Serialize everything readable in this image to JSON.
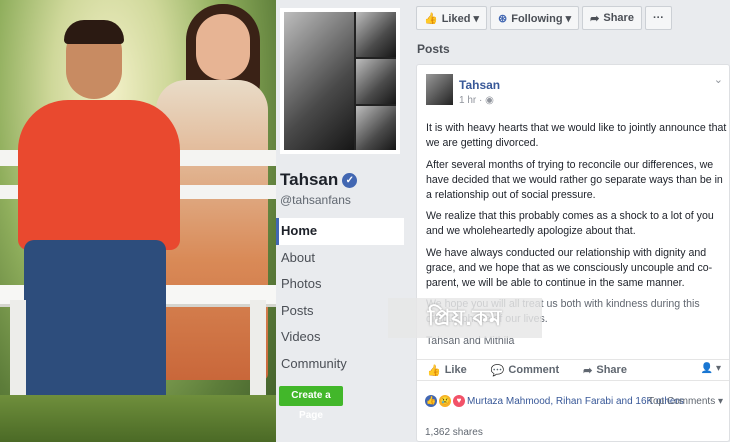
{
  "photo": {
    "alt": ""
  },
  "page": {
    "name": "Tahsan",
    "handle": "@tahsanfans",
    "verified_icon": "verified-check-icon"
  },
  "nav": [
    "Home",
    "About",
    "Photos",
    "Posts",
    "Videos",
    "Community"
  ],
  "create_page": "Create a Page",
  "topbar": {
    "liked": "Liked ▾",
    "following": "Following ▾",
    "share": "Share",
    "more": "···"
  },
  "posts_label": "Posts",
  "post": {
    "author": "Tahsan",
    "time": "1 hr · ◉",
    "paragraphs": [
      "It is with heavy hearts that we would like to jointly announce that we are getting divorced.",
      "After several months of trying to reconcile our differences, we have decided that we would rather go separate ways than be in a relationship out of social pressure.",
      "We realize that this probably comes as a shock to a lot of you and we wholeheartedly apologize about that.",
      "We have always conducted our relationship with dignity and grace, and we hope that as we consciously uncouple and co-parent, we will be able to continue in the same manner.",
      "We hope you will all treat us both with kindness during this difficult phase of our lives."
    ],
    "signoff": "Tahsan and Mithila",
    "actions": {
      "like": "Like",
      "comment": "Comment",
      "share": "Share"
    },
    "reactions_text": "Murtaza Mahmood, Rihan Farabi and 16K others",
    "top_comments": "Top Comments ▾",
    "shares": "1,362 shares"
  },
  "watermark": "প্রিয়.কম",
  "colors": {
    "fb_blue": "#4267b2",
    "link": "#385898",
    "green": "#42b72a"
  }
}
